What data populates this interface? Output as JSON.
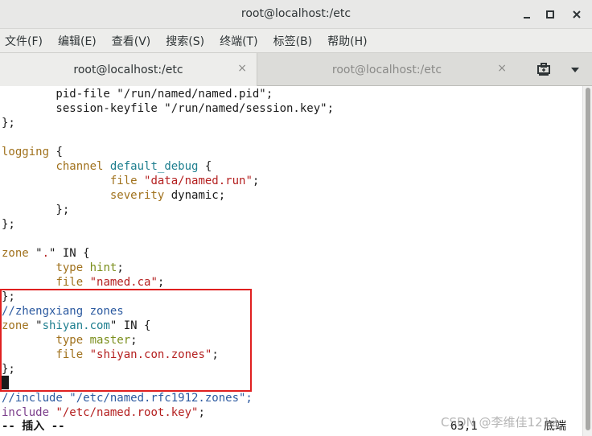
{
  "window": {
    "title": "root@localhost:/etc",
    "controls": {
      "minimize_icon": "minimize-icon",
      "maximize_icon": "maximize-icon",
      "close_icon": "close-icon"
    }
  },
  "menubar": {
    "items": [
      "文件(F)",
      "编辑(E)",
      "查看(V)",
      "搜索(S)",
      "终端(T)",
      "标签(B)",
      "帮助(H)"
    ]
  },
  "tabs": [
    {
      "label": "root@localhost:/etc",
      "active": true,
      "close": "×"
    },
    {
      "label": "root@localhost:/etc",
      "active": false,
      "close": "×"
    }
  ],
  "terminal": {
    "lines": [
      {
        "parts": [
          {
            "t": "        pid-file \"/run/named/named.pid\";",
            "c": "plain"
          }
        ]
      },
      {
        "parts": [
          {
            "t": "        session-keyfile \"/run/named/session.key\";",
            "c": "plain"
          }
        ]
      },
      {
        "parts": [
          {
            "t": "};",
            "c": "plain"
          }
        ]
      },
      {
        "parts": []
      },
      {
        "parts": [
          {
            "t": "logging",
            "c": "kw-orange"
          },
          {
            "t": " {",
            "c": "plain"
          }
        ]
      },
      {
        "parts": [
          {
            "t": "        ",
            "c": "plain"
          },
          {
            "t": "channel",
            "c": "kw-orange"
          },
          {
            "t": " ",
            "c": "plain"
          },
          {
            "t": "default_debug",
            "c": "kw-teal"
          },
          {
            "t": " {",
            "c": "plain"
          }
        ]
      },
      {
        "parts": [
          {
            "t": "                ",
            "c": "plain"
          },
          {
            "t": "file",
            "c": "kw-orange"
          },
          {
            "t": " ",
            "c": "plain"
          },
          {
            "t": "\"data/named.run\"",
            "c": "str-red"
          },
          {
            "t": ";",
            "c": "plain"
          }
        ]
      },
      {
        "parts": [
          {
            "t": "                ",
            "c": "plain"
          },
          {
            "t": "severity",
            "c": "kw-orange"
          },
          {
            "t": " dynamic;",
            "c": "plain"
          }
        ]
      },
      {
        "parts": [
          {
            "t": "        };",
            "c": "plain"
          }
        ]
      },
      {
        "parts": [
          {
            "t": "};",
            "c": "plain"
          }
        ]
      },
      {
        "parts": []
      },
      {
        "parts": [
          {
            "t": "zone",
            "c": "kw-orange"
          },
          {
            "t": " \"",
            "c": "plain"
          },
          {
            "t": ".",
            "c": "str-red"
          },
          {
            "t": "\" IN {",
            "c": "plain"
          }
        ]
      },
      {
        "parts": [
          {
            "t": "        ",
            "c": "plain"
          },
          {
            "t": "type",
            "c": "kw-orange"
          },
          {
            "t": " ",
            "c": "plain"
          },
          {
            "t": "hint",
            "c": "kw-green"
          },
          {
            "t": ";",
            "c": "plain"
          }
        ]
      },
      {
        "parts": [
          {
            "t": "        ",
            "c": "plain"
          },
          {
            "t": "file",
            "c": "kw-orange"
          },
          {
            "t": " ",
            "c": "plain"
          },
          {
            "t": "\"named.ca\"",
            "c": "str-red"
          },
          {
            "t": ";",
            "c": "plain"
          }
        ]
      },
      {
        "parts": [
          {
            "t": "};",
            "c": "plain"
          }
        ]
      },
      {
        "parts": [
          {
            "t": "//zhengxiang zones",
            "c": "comment"
          }
        ]
      },
      {
        "parts": [
          {
            "t": "zone",
            "c": "kw-orange"
          },
          {
            "t": " \"",
            "c": "plain"
          },
          {
            "t": "shiyan.com",
            "c": "kw-teal"
          },
          {
            "t": "\" IN {",
            "c": "plain"
          }
        ]
      },
      {
        "parts": [
          {
            "t": "        ",
            "c": "plain"
          },
          {
            "t": "type",
            "c": "kw-orange"
          },
          {
            "t": " ",
            "c": "plain"
          },
          {
            "t": "master",
            "c": "kw-green"
          },
          {
            "t": ";",
            "c": "plain"
          }
        ]
      },
      {
        "parts": [
          {
            "t": "        ",
            "c": "plain"
          },
          {
            "t": "file",
            "c": "kw-orange"
          },
          {
            "t": " ",
            "c": "plain"
          },
          {
            "t": "\"shiyan.con.zones\"",
            "c": "str-red"
          },
          {
            "t": ";",
            "c": "plain"
          }
        ]
      },
      {
        "parts": [
          {
            "t": "};",
            "c": "plain"
          }
        ]
      },
      {
        "parts": []
      },
      {
        "parts": [
          {
            "t": "//include \"/etc/named.rfc1912.zones\";",
            "c": "comment"
          }
        ]
      },
      {
        "parts": [
          {
            "t": "include",
            "c": "kw-purple"
          },
          {
            "t": " ",
            "c": "plain"
          },
          {
            "t": "\"/etc/named.root.key\"",
            "c": "str-red"
          },
          {
            "t": ";",
            "c": "plain"
          }
        ]
      }
    ]
  },
  "status": {
    "mode": "-- 插入 --",
    "position": "63,1",
    "scroll": "底端"
  },
  "watermark": "CSDN @李维佳1212"
}
